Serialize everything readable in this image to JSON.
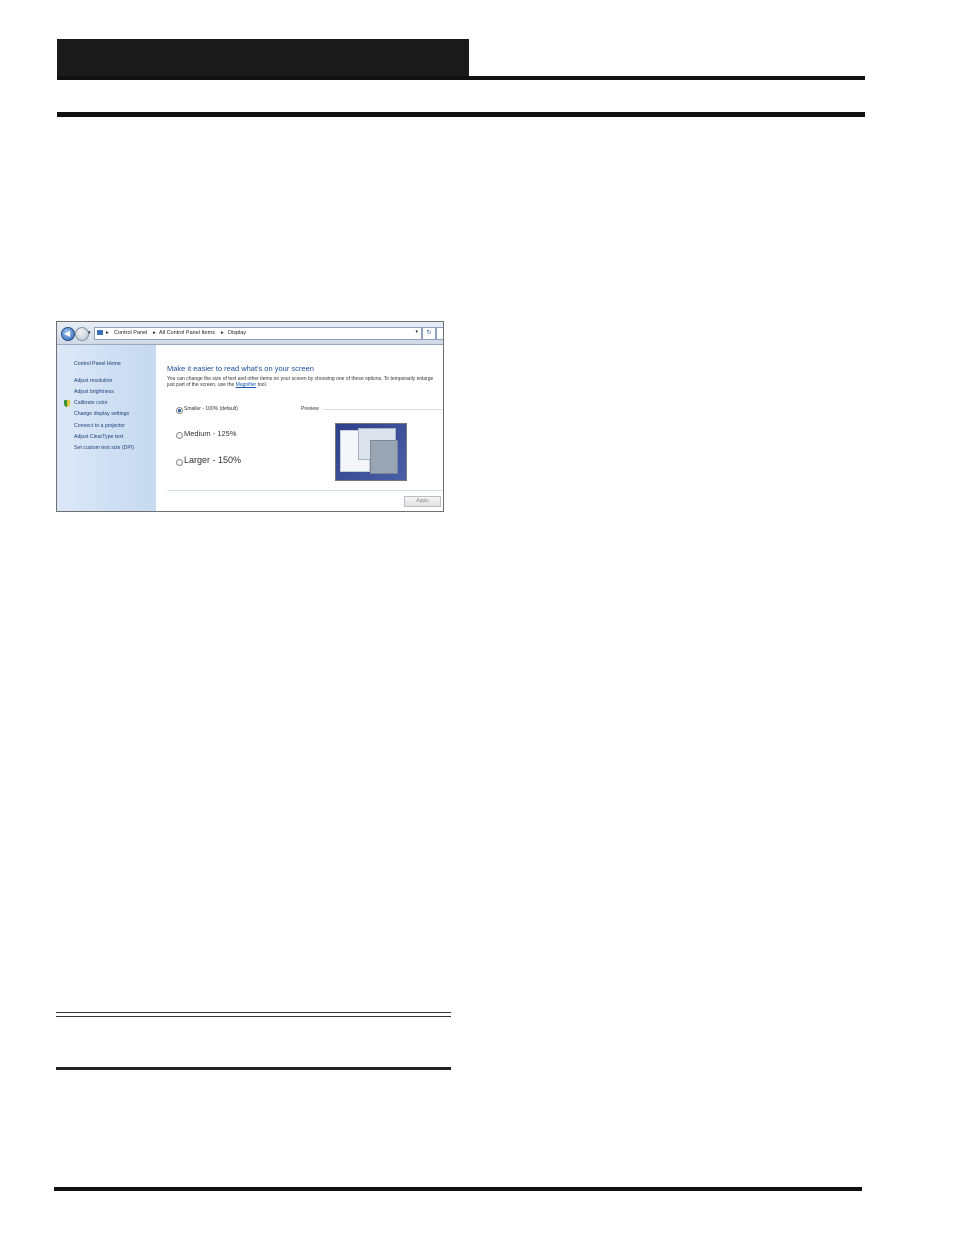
{
  "window": {
    "breadcrumb": [
      "Control Panel",
      "All Control Panel Items",
      "Display"
    ],
    "sidebar": {
      "home": "Control Panel Home",
      "items": [
        "Adjust resolution",
        "Adjust brightness",
        "Calibrate color",
        "Change display settings",
        "Connect to a projector",
        "Adjust ClearType text",
        "Set custom text size (DPI)"
      ]
    },
    "main": {
      "title": "Make it easier to read what's on your screen",
      "desc_before": "You can change the size of text and other items on your screen by choosing one of these options. To temporarily enlarge just part of the screen, use the ",
      "desc_link": "Magnifier",
      "desc_after": " tool.",
      "options": [
        "Smaller - 100% (default)",
        "Medium - 125%",
        "Larger - 150%"
      ],
      "selected_index": 0,
      "preview_label": "Preview",
      "apply_label": "Apply"
    },
    "icons": {
      "back": "back-arrow-icon",
      "forward": "forward-arrow-icon",
      "refresh": "refresh-icon"
    }
  }
}
